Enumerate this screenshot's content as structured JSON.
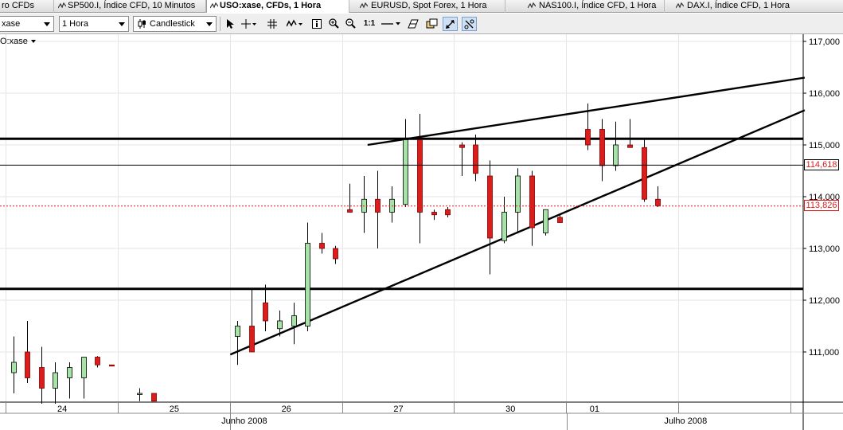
{
  "tabs": [
    {
      "label": "ro CFDs",
      "active": false
    },
    {
      "label": "SP500.I, Índice CFD, 10 Minutos",
      "active": false
    },
    {
      "label": "USO:xase, CFDs, 1 Hora",
      "active": true
    },
    {
      "label": "EURUSD, Spot Forex, 1 Hora",
      "active": false
    },
    {
      "label": "NAS100.I, Índice CFD, 1 Hora",
      "active": false
    },
    {
      "label": "DAX.I, Índice CFD, 1 Hora",
      "active": false
    }
  ],
  "toolbar": {
    "symbol_value": "xase",
    "interval_value": "1 Hora",
    "chart_type_value": "Candlestick",
    "ratio_label": "1:1"
  },
  "symbol_label": "O:xase",
  "current_price_label": "113,826",
  "crosshair_price_label": "114,618",
  "colors": {
    "up": "#a6e3a6",
    "down": "#dd1c1c",
    "current_line": "#dd1c1c"
  },
  "chart_data": {
    "type": "candlestick",
    "y_ticks": [
      "117,000",
      "116,000",
      "115,000",
      "114,000",
      "113,000",
      "112,000",
      "111,000"
    ],
    "y_tick_values": [
      117,
      116,
      115,
      114,
      113,
      112,
      111
    ],
    "x_labels": [
      {
        "text": "24",
        "slot": 2
      },
      {
        "text": "25",
        "slot": 10
      },
      {
        "text": "26",
        "slot": 18
      },
      {
        "text": "27",
        "slot": 26
      },
      {
        "text": "30",
        "slot": 34
      },
      {
        "text": "01",
        "slot": 40
      }
    ],
    "month_labels": [
      {
        "text": "Junho 2008",
        "slot": 16.5
      },
      {
        "text": "Julho 2008",
        "slot": 48
      }
    ],
    "candles": [
      {
        "open": 110.6,
        "high": 111.3,
        "low": 110.2,
        "close": 110.8
      },
      {
        "open": 111.0,
        "high": 111.6,
        "low": 110.4,
        "close": 110.5
      },
      {
        "open": 110.7,
        "high": 111.1,
        "low": 110.0,
        "close": 110.3
      },
      {
        "open": 110.3,
        "high": 110.8,
        "low": 110.0,
        "close": 110.6
      },
      {
        "open": 110.5,
        "high": 110.8,
        "low": 110.1,
        "close": 110.7
      },
      {
        "open": 110.5,
        "high": 110.9,
        "low": 110.1,
        "close": 110.9
      },
      {
        "open": 110.9,
        "high": 110.92,
        "low": 110.7,
        "close": 110.75
      },
      {
        "open": 110.75,
        "high": 110.75,
        "low": 110.73,
        "close": 110.73
      },
      null,
      {
        "open": 110.18,
        "high": 110.3,
        "low": 110.05,
        "close": 110.2
      },
      {
        "open": 110.2,
        "high": 110.2,
        "low": 110.05,
        "close": 110.05
      },
      null,
      null,
      null,
      null,
      null,
      {
        "open": 111.3,
        "high": 111.6,
        "low": 110.75,
        "close": 111.5
      },
      {
        "open": 111.5,
        "high": 112.2,
        "low": 111.0,
        "close": 111.0
      },
      {
        "open": 111.95,
        "high": 112.3,
        "low": 111.4,
        "close": 111.6
      },
      {
        "open": 111.45,
        "high": 111.8,
        "low": 111.3,
        "close": 111.6
      },
      {
        "open": 111.5,
        "high": 111.95,
        "low": 111.15,
        "close": 111.7
      },
      {
        "open": 111.5,
        "high": 113.5,
        "low": 111.4,
        "close": 113.1
      },
      {
        "open": 113.1,
        "high": 113.3,
        "low": 112.9,
        "close": 113.0
      },
      {
        "open": 113.0,
        "high": 113.05,
        "low": 112.7,
        "close": 112.8
      },
      {
        "open": 113.75,
        "high": 114.25,
        "low": 113.7,
        "close": 113.7
      },
      {
        "open": 113.7,
        "high": 114.4,
        "low": 113.3,
        "close": 113.95
      },
      {
        "open": 113.95,
        "high": 114.5,
        "low": 113.0,
        "close": 113.7
      },
      {
        "open": 113.7,
        "high": 114.2,
        "low": 113.5,
        "close": 113.95
      },
      {
        "open": 113.85,
        "high": 115.5,
        "low": 113.8,
        "close": 115.1
      },
      {
        "open": 115.1,
        "high": 115.6,
        "low": 113.1,
        "close": 113.7
      },
      {
        "open": 113.7,
        "high": 113.75,
        "low": 113.55,
        "close": 113.65
      },
      {
        "open": 113.75,
        "high": 113.8,
        "low": 113.6,
        "close": 113.65
      },
      {
        "open": 115.0,
        "high": 115.05,
        "low": 114.4,
        "close": 114.95
      },
      {
        "open": 115.0,
        "high": 115.2,
        "low": 114.3,
        "close": 114.45
      },
      {
        "open": 114.4,
        "high": 114.7,
        "low": 112.5,
        "close": 113.2
      },
      {
        "open": 113.15,
        "high": 114.0,
        "low": 113.1,
        "close": 113.7
      },
      {
        "open": 113.7,
        "high": 114.55,
        "low": 113.3,
        "close": 114.4
      },
      {
        "open": 114.4,
        "high": 114.5,
        "low": 113.05,
        "close": 113.4
      },
      {
        "open": 113.3,
        "high": 113.7,
        "low": 113.25,
        "close": 113.75
      },
      {
        "open": 113.6,
        "high": 113.65,
        "low": 113.5,
        "close": 113.5
      },
      null,
      {
        "open": 115.3,
        "high": 115.8,
        "low": 114.9,
        "close": 115.0
      },
      {
        "open": 115.3,
        "high": 115.5,
        "low": 114.3,
        "close": 114.6
      },
      {
        "open": 114.6,
        "high": 115.45,
        "low": 114.5,
        "close": 115.0
      },
      {
        "open": 115.0,
        "high": 115.5,
        "low": 114.95,
        "close": 114.95
      },
      {
        "open": 114.95,
        "high": 115.1,
        "low": 113.9,
        "close": 113.95
      },
      {
        "open": 113.95,
        "high": 114.2,
        "low": 113.8,
        "close": 113.826
      }
    ],
    "horizontal_lines": [
      115.12,
      112.22
    ],
    "trend_lines": [
      {
        "from": {
          "slot": 15.5,
          "price": 110.95
        },
        "to": {
          "slot": 56.5,
          "price": 115.67
        }
      },
      {
        "from": {
          "slot": 25.3,
          "price": 115.0
        },
        "to": {
          "slot": 56.5,
          "price": 116.3
        }
      }
    ]
  }
}
